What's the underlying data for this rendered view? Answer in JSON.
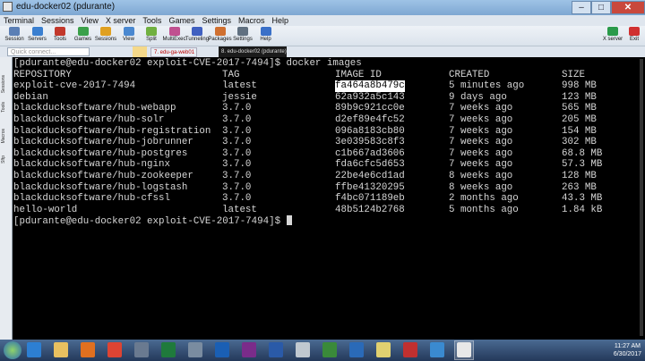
{
  "window": {
    "title": "edu-docker02 (pdurante)"
  },
  "menu": [
    "Terminal",
    "Sessions",
    "View",
    "X server",
    "Tools",
    "Games",
    "Settings",
    "Macros",
    "Help"
  ],
  "toolbar": {
    "left": [
      {
        "label": "Session",
        "color": "#5b7fb5"
      },
      {
        "label": "Servers",
        "color": "#3a7fd0"
      },
      {
        "label": "Tools",
        "color": "#c2382c"
      },
      {
        "label": "Games",
        "color": "#3aa04a"
      },
      {
        "label": "Sessions",
        "color": "#e0a020"
      },
      {
        "label": "View",
        "color": "#4a88d0"
      },
      {
        "label": "Split",
        "color": "#70b040"
      },
      {
        "label": "MultiExec",
        "color": "#c05090"
      },
      {
        "label": "Tunneling",
        "color": "#4060c0"
      },
      {
        "label": "Packages",
        "color": "#d07030"
      },
      {
        "label": "Settings",
        "color": "#607080"
      },
      {
        "label": "Help",
        "color": "#3a70c8"
      }
    ],
    "right": [
      {
        "label": "X server",
        "color": "#2a9a4a"
      },
      {
        "label": "Exit",
        "color": "#d03030"
      }
    ]
  },
  "quick_connect": {
    "placeholder": "Quick connect..."
  },
  "tabs": [
    {
      "label": "7. edu-ga-web01"
    },
    {
      "label": "8. edu-docker02 (pdurante)"
    }
  ],
  "sidebar_tabs": [
    "Sessions",
    "Tools",
    "Macros",
    "Sftp"
  ],
  "terminal": {
    "prompt_cmd": "[pdurante@edu-docker02 exploit-CVE-2017-7494]$ docker images",
    "headers": [
      "REPOSITORY",
      "TAG",
      "IMAGE ID",
      "CREATED",
      "SIZE"
    ],
    "rows": [
      [
        "exploit-cve-2017-7494",
        "latest",
        "fa464a8b479c",
        "5 minutes ago",
        "998 MB"
      ],
      [
        "debian",
        "jessie",
        "62a932a5c143",
        "9 days ago",
        "123 MB"
      ],
      [
        "blackducksoftware/hub-webapp",
        "3.7.0",
        "89b9c921cc0e",
        "7 weeks ago",
        "565 MB"
      ],
      [
        "blackducksoftware/hub-solr",
        "3.7.0",
        "d2ef89e4fc52",
        "7 weeks ago",
        "205 MB"
      ],
      [
        "blackducksoftware/hub-registration",
        "3.7.0",
        "096a8183cb80",
        "7 weeks ago",
        "154 MB"
      ],
      [
        "blackducksoftware/hub-jobrunner",
        "3.7.0",
        "3e039583c8f3",
        "7 weeks ago",
        "302 MB"
      ],
      [
        "blackducksoftware/hub-postgres",
        "3.7.0",
        "c1b667ad3606",
        "7 weeks ago",
        "68.8 MB"
      ],
      [
        "blackducksoftware/hub-nginx",
        "3.7.0",
        "fda6cfc5d653",
        "7 weeks ago",
        "57.3 MB"
      ],
      [
        "blackducksoftware/hub-zookeeper",
        "3.7.0",
        "22be4e6cd1ad",
        "8 weeks ago",
        "128 MB"
      ],
      [
        "blackducksoftware/hub-logstash",
        "3.7.0",
        "ffbe41320295",
        "8 weeks ago",
        "263 MB"
      ],
      [
        "blackducksoftware/hub-cfssl",
        "3.7.0",
        "f4bc071189eb",
        "2 months ago",
        "43.3 MB"
      ],
      [
        "hello-world",
        "latest",
        "48b5124b2768",
        "5 months ago",
        "1.84 kB"
      ]
    ],
    "prompt_end": "[pdurante@edu-docker02 exploit-CVE-2017-7494]$ ",
    "selected_image_id": "fa464a8b479c"
  },
  "taskbar": {
    "apps": [
      {
        "name": "ie-icon",
        "color": "#2d7fd3"
      },
      {
        "name": "folder-icon",
        "color": "#e8c060"
      },
      {
        "name": "media-player-icon",
        "color": "#e07020"
      },
      {
        "name": "chrome-icon",
        "color": "#dd4433"
      },
      {
        "name": "tool-icon",
        "color": "#6a7a90"
      },
      {
        "name": "excel-icon",
        "color": "#1f7a3c"
      },
      {
        "name": "calculator-icon",
        "color": "#7a8ca0"
      },
      {
        "name": "outlook-icon",
        "color": "#1a5fb4"
      },
      {
        "name": "onenote-icon",
        "color": "#7a2c8a"
      },
      {
        "name": "word-icon",
        "color": "#2a5aa8"
      },
      {
        "name": "documents-icon",
        "color": "#c0c8d0"
      },
      {
        "name": "camtasia-icon",
        "color": "#3a8a3a"
      },
      {
        "name": "lync-icon",
        "color": "#2a6ab8"
      },
      {
        "name": "notes-icon",
        "color": "#e0d070"
      },
      {
        "name": "vpn-icon",
        "color": "#c03030"
      },
      {
        "name": "network-icon",
        "color": "#3a8ad0"
      },
      {
        "name": "mobaxterm-icon",
        "color": "#e8e8e8"
      }
    ],
    "clock_time": "11:27 AM",
    "clock_date": "6/30/2017"
  }
}
